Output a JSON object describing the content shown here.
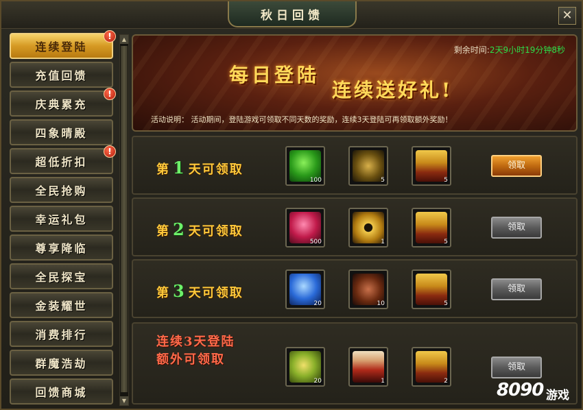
{
  "window": {
    "title": "秋日回馈",
    "close_label": "✕"
  },
  "sidebar": {
    "items": [
      {
        "label": "连续登陆",
        "active": true,
        "badge": "!"
      },
      {
        "label": "充值回馈",
        "active": false,
        "badge": ""
      },
      {
        "label": "庆典累充",
        "active": false,
        "badge": "!"
      },
      {
        "label": "四象晴殿",
        "active": false,
        "badge": ""
      },
      {
        "label": "超低折扣",
        "active": false,
        "badge": "!"
      },
      {
        "label": "全民抢购",
        "active": false,
        "badge": ""
      },
      {
        "label": "幸运礼包",
        "active": false,
        "badge": ""
      },
      {
        "label": "尊享降临",
        "active": false,
        "badge": ""
      },
      {
        "label": "全民探宝",
        "active": false,
        "badge": ""
      },
      {
        "label": "金装耀世",
        "active": false,
        "badge": ""
      },
      {
        "label": "消费排行",
        "active": false,
        "badge": ""
      },
      {
        "label": "群魔浩劫",
        "active": false,
        "badge": ""
      },
      {
        "label": "回馈商城",
        "active": false,
        "badge": ""
      }
    ]
  },
  "banner": {
    "remaining_label": "剩余时间:",
    "remaining_value": "2天9小时19分钟8秒",
    "title_line1": "每日登陆",
    "title_line2": "连续送好礼!",
    "description": "活动说明：  活动期间，登陆游戏可领取不同天数的奖励，连续3天登陆可再领取额外奖励！"
  },
  "rewards": [
    {
      "prefix": "第",
      "day": "1",
      "suffix": "天可领取",
      "items": [
        {
          "icon": "jade-pendant-icon",
          "count": "100"
        },
        {
          "icon": "talisman-icon",
          "count": "5"
        },
        {
          "icon": "gold-chest-icon",
          "count": "5"
        }
      ],
      "button": "领取",
      "claimable": true
    },
    {
      "prefix": "第",
      "day": "2",
      "suffix": "天可领取",
      "items": [
        {
          "icon": "ruby-crystal-icon",
          "count": "500"
        },
        {
          "icon": "gold-coin-icon",
          "count": "1"
        },
        {
          "icon": "gold-chest-icon",
          "count": "5"
        }
      ],
      "button": "领取",
      "claimable": false
    },
    {
      "prefix": "第",
      "day": "3",
      "suffix": "天可领取",
      "items": [
        {
          "icon": "sapphire-crystal-icon",
          "count": "20"
        },
        {
          "icon": "rune-stone-icon",
          "count": "10"
        },
        {
          "icon": "gold-chest-icon",
          "count": "5"
        }
      ],
      "button": "领取",
      "claimable": false
    }
  ],
  "bonus": {
    "line1": "连续3天登陆",
    "line2": "额外可领取",
    "items": [
      {
        "icon": "gold-leaf-ornament-icon",
        "count": "20"
      },
      {
        "icon": "red-scroll-icon",
        "count": "1"
      },
      {
        "icon": "gold-chest-icon",
        "count": "2"
      }
    ],
    "button": "领取",
    "claimable": false
  },
  "watermark": {
    "digits": "8090",
    "text": "游戏"
  }
}
